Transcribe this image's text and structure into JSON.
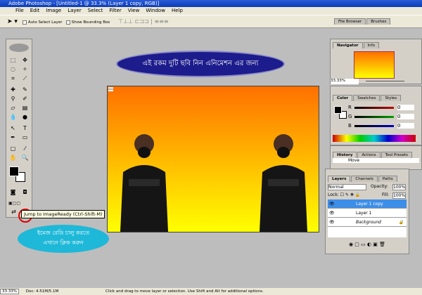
{
  "window": {
    "title": "Adobe Photoshop - [Untitled-1 @ 33.3% (Layer 1 copy, RGB)]"
  },
  "menu": [
    "File",
    "Edit",
    "Image",
    "Layer",
    "Select",
    "Filter",
    "View",
    "Window",
    "Help"
  ],
  "options": {
    "auto_select": "Auto Select Layer",
    "bounding_box": "Show Bounding Box"
  },
  "palette_well": {
    "tabs": [
      "File Browser",
      "Brushes"
    ]
  },
  "annotations": {
    "top": "এই রকম দুটি ছবি নিন এনিমেশন এর জন্য",
    "bottom_line1": "ইমেজ রেডি চালু করতে",
    "bottom_line2": "এখানে ক্লিক করুন"
  },
  "tooltip": "Jump to ImageReady (Ctrl-Shift-M)",
  "navigator": {
    "tabs": [
      "Navigator",
      "Info"
    ],
    "zoom": "33.33%"
  },
  "color": {
    "tabs": [
      "Color",
      "Swatches",
      "Styles"
    ],
    "channels": [
      {
        "label": "R",
        "value": "0",
        "color": "#c00000"
      },
      {
        "label": "G",
        "value": "0",
        "color": "#00a000"
      },
      {
        "label": "B",
        "value": "0",
        "color": "#0000c0"
      }
    ]
  },
  "history": {
    "tabs": [
      "History",
      "Actions",
      "Tool Presets"
    ],
    "items": [
      "Move"
    ]
  },
  "layers": {
    "tabs": [
      "Layers",
      "Channels",
      "Paths"
    ],
    "blend": "Normal",
    "opacity_label": "Opacity:",
    "opacity": "100%",
    "lock_label": "Lock:",
    "fill_label": "Fill:",
    "fill": "100%",
    "items": [
      "Layer 1 copy",
      "Layer 1",
      "Background"
    ]
  },
  "status": {
    "zoom": "33.33%",
    "doc": "Doc: 4.51M/5.1M",
    "hint": "Click and drag to move layer or selection.  Use Shift and Alt for additional options."
  }
}
